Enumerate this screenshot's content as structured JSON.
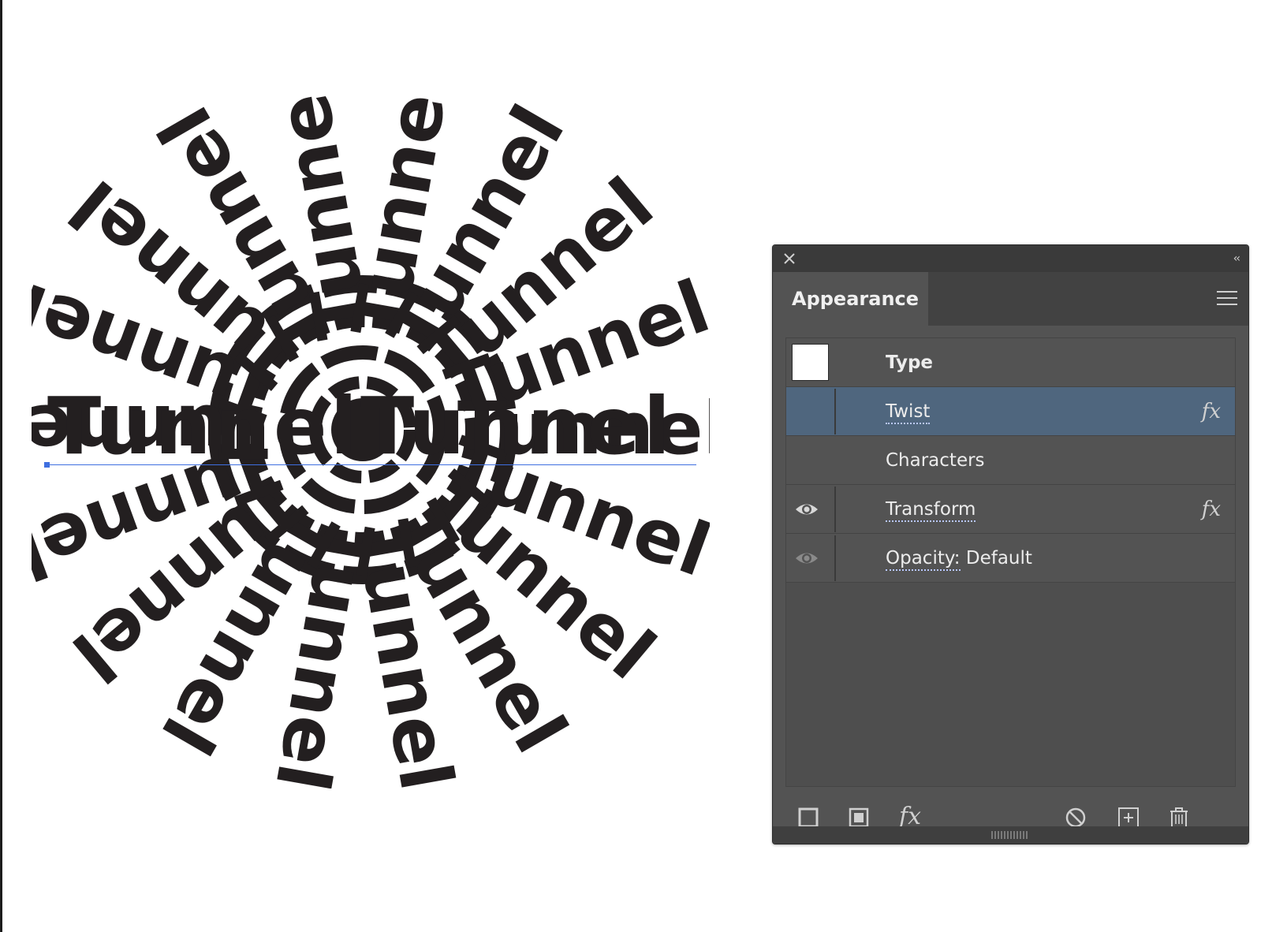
{
  "canvas": {
    "word": "Tunnel"
  },
  "panel": {
    "tab_title": "Appearance",
    "icons": {
      "close": "close-icon",
      "collapse": "double-chevron-left-icon",
      "menu": "hamburger-menu-icon"
    },
    "rows": [
      {
        "label": "Type",
        "bold": true,
        "swatch_color": "#ffffff"
      },
      {
        "label": "Twist",
        "fx": "fx",
        "selected": true
      },
      {
        "label": "Characters"
      },
      {
        "label": "Transform",
        "fx": "fx",
        "visible": true
      },
      {
        "label_prefix": "Opacity:",
        "label_value": " Default",
        "visible": true
      }
    ],
    "footer": {
      "fx_label": "fx",
      "icons": [
        "add-new-stroke-icon",
        "add-new-fill-icon",
        "add-new-effect-icon",
        "clear-appearance-icon",
        "duplicate-item-icon",
        "delete-item-icon"
      ]
    }
  },
  "colors": {
    "panel_bg": "#535353",
    "selection": "#4f667e",
    "baseline": "#3f6fe0",
    "art": "#231f20"
  }
}
